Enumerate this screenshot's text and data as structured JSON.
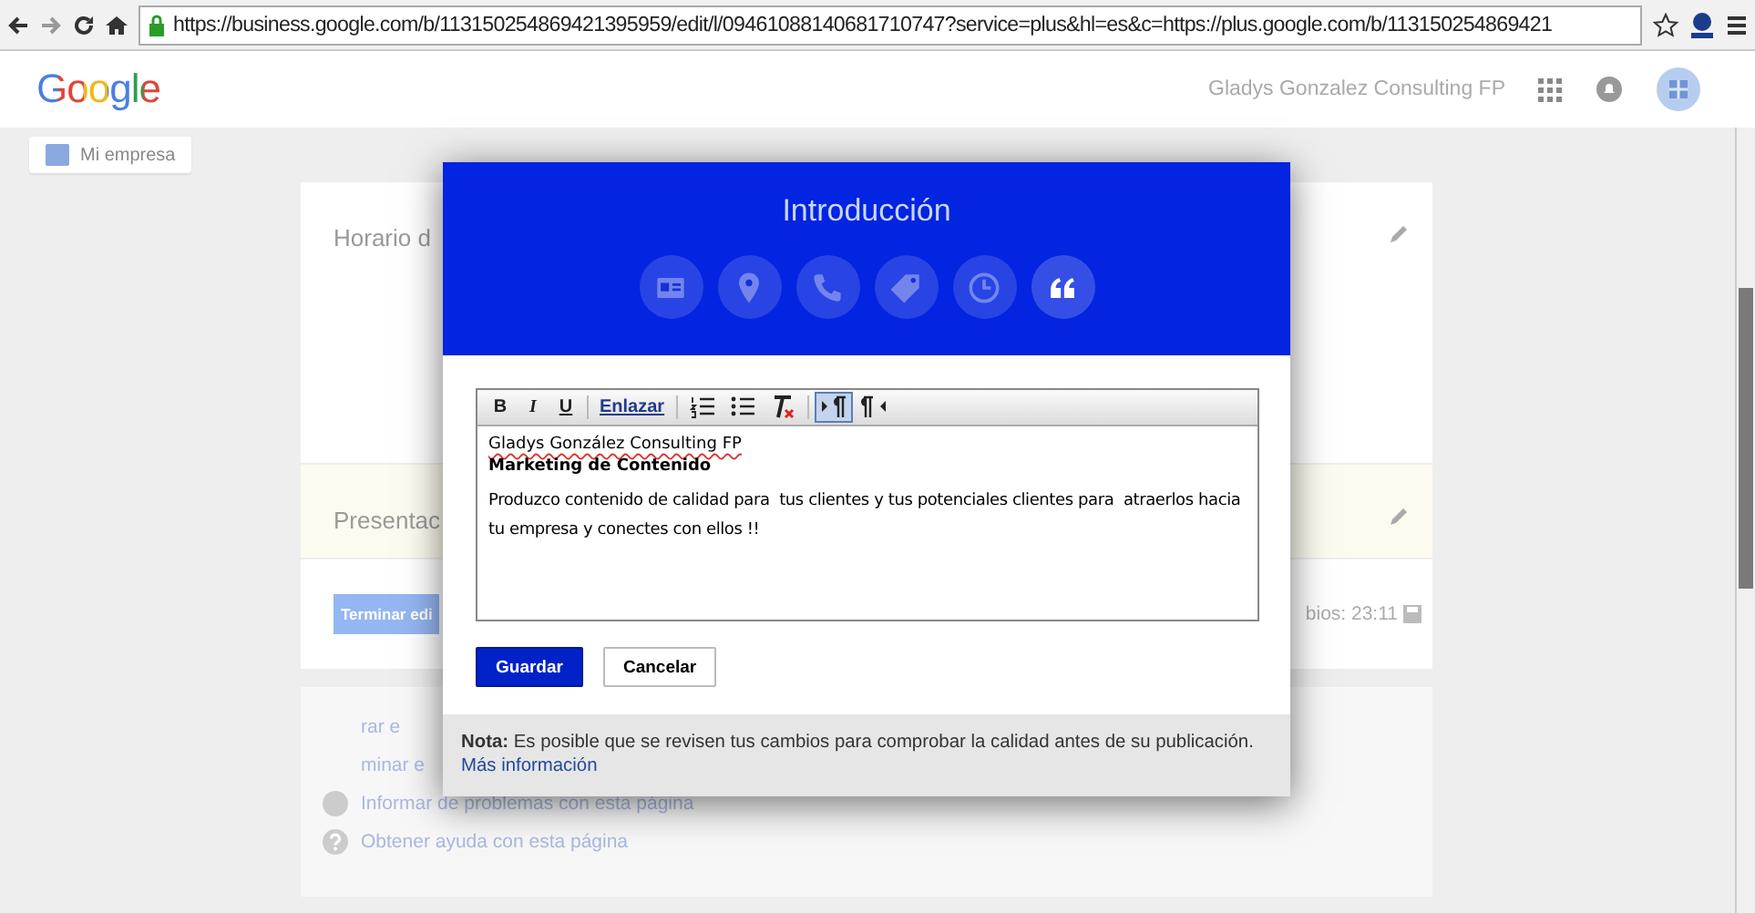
{
  "browser": {
    "url": "https://business.google.com/b/113150254869421395959/edit/l/09461088140681710747?service=plus&hl=es&c=https://plus.google.com/b/113150254869421"
  },
  "header": {
    "logo": "Google",
    "account": "Gladys Gonzalez Consulting FP"
  },
  "breadcrumb": {
    "label": "Mi empresa"
  },
  "cards": [
    {
      "kind": "plain",
      "title": "Horario d"
    },
    {
      "kind": "highlight",
      "title": "Presentac"
    }
  ],
  "edit_bar": {
    "button": "Terminar edi",
    "status": "bios: 23:11"
  },
  "links": [
    {
      "kind": "none",
      "label": "rar e"
    },
    {
      "kind": "none",
      "label": "minar e"
    },
    {
      "kind": "report",
      "label": "Informar de problemas con esta página"
    },
    {
      "kind": "help",
      "label": "Obtener ayuda con esta página"
    }
  ],
  "dialog": {
    "title": "Introducción",
    "sections": [
      {
        "kind": "card",
        "selected": false
      },
      {
        "kind": "pin",
        "selected": false
      },
      {
        "kind": "phone",
        "selected": false
      },
      {
        "kind": "tag",
        "selected": false
      },
      {
        "kind": "clock",
        "selected": false
      },
      {
        "kind": "quote",
        "selected": true
      }
    ],
    "toolbar": [
      {
        "kind": "bold",
        "label": "B",
        "pressed": false
      },
      {
        "kind": "italic",
        "label": "I",
        "pressed": false
      },
      {
        "kind": "underline",
        "label": "U",
        "pressed": false
      },
      {
        "kind": "link",
        "label": "Enlazar",
        "pressed": false
      },
      {
        "kind": "ordered-list",
        "pressed": false
      },
      {
        "kind": "bullet-list",
        "pressed": false
      },
      {
        "kind": "clear-format",
        "pressed": false
      },
      {
        "kind": "ltr",
        "pressed": true
      },
      {
        "kind": "rtl",
        "pressed": false
      }
    ],
    "editor": {
      "name": "Gladys González Consulting FP",
      "subtitle": "Marketing de Contenido",
      "text": "Produzco contenido de calidad para  tus clientes y tus potenciales clientes para  atraerlos hacia tu empresa y conectes con ellos !!"
    },
    "buttons": [
      {
        "kind": "primary",
        "label": "Guardar"
      },
      {
        "kind": "secondary",
        "label": "Cancelar"
      }
    ],
    "note": {
      "text": "**Nota:** Es posible que se revisen tus cambios para comprobar la calidad antes de su publicación.",
      "link": "Más información"
    }
  }
}
